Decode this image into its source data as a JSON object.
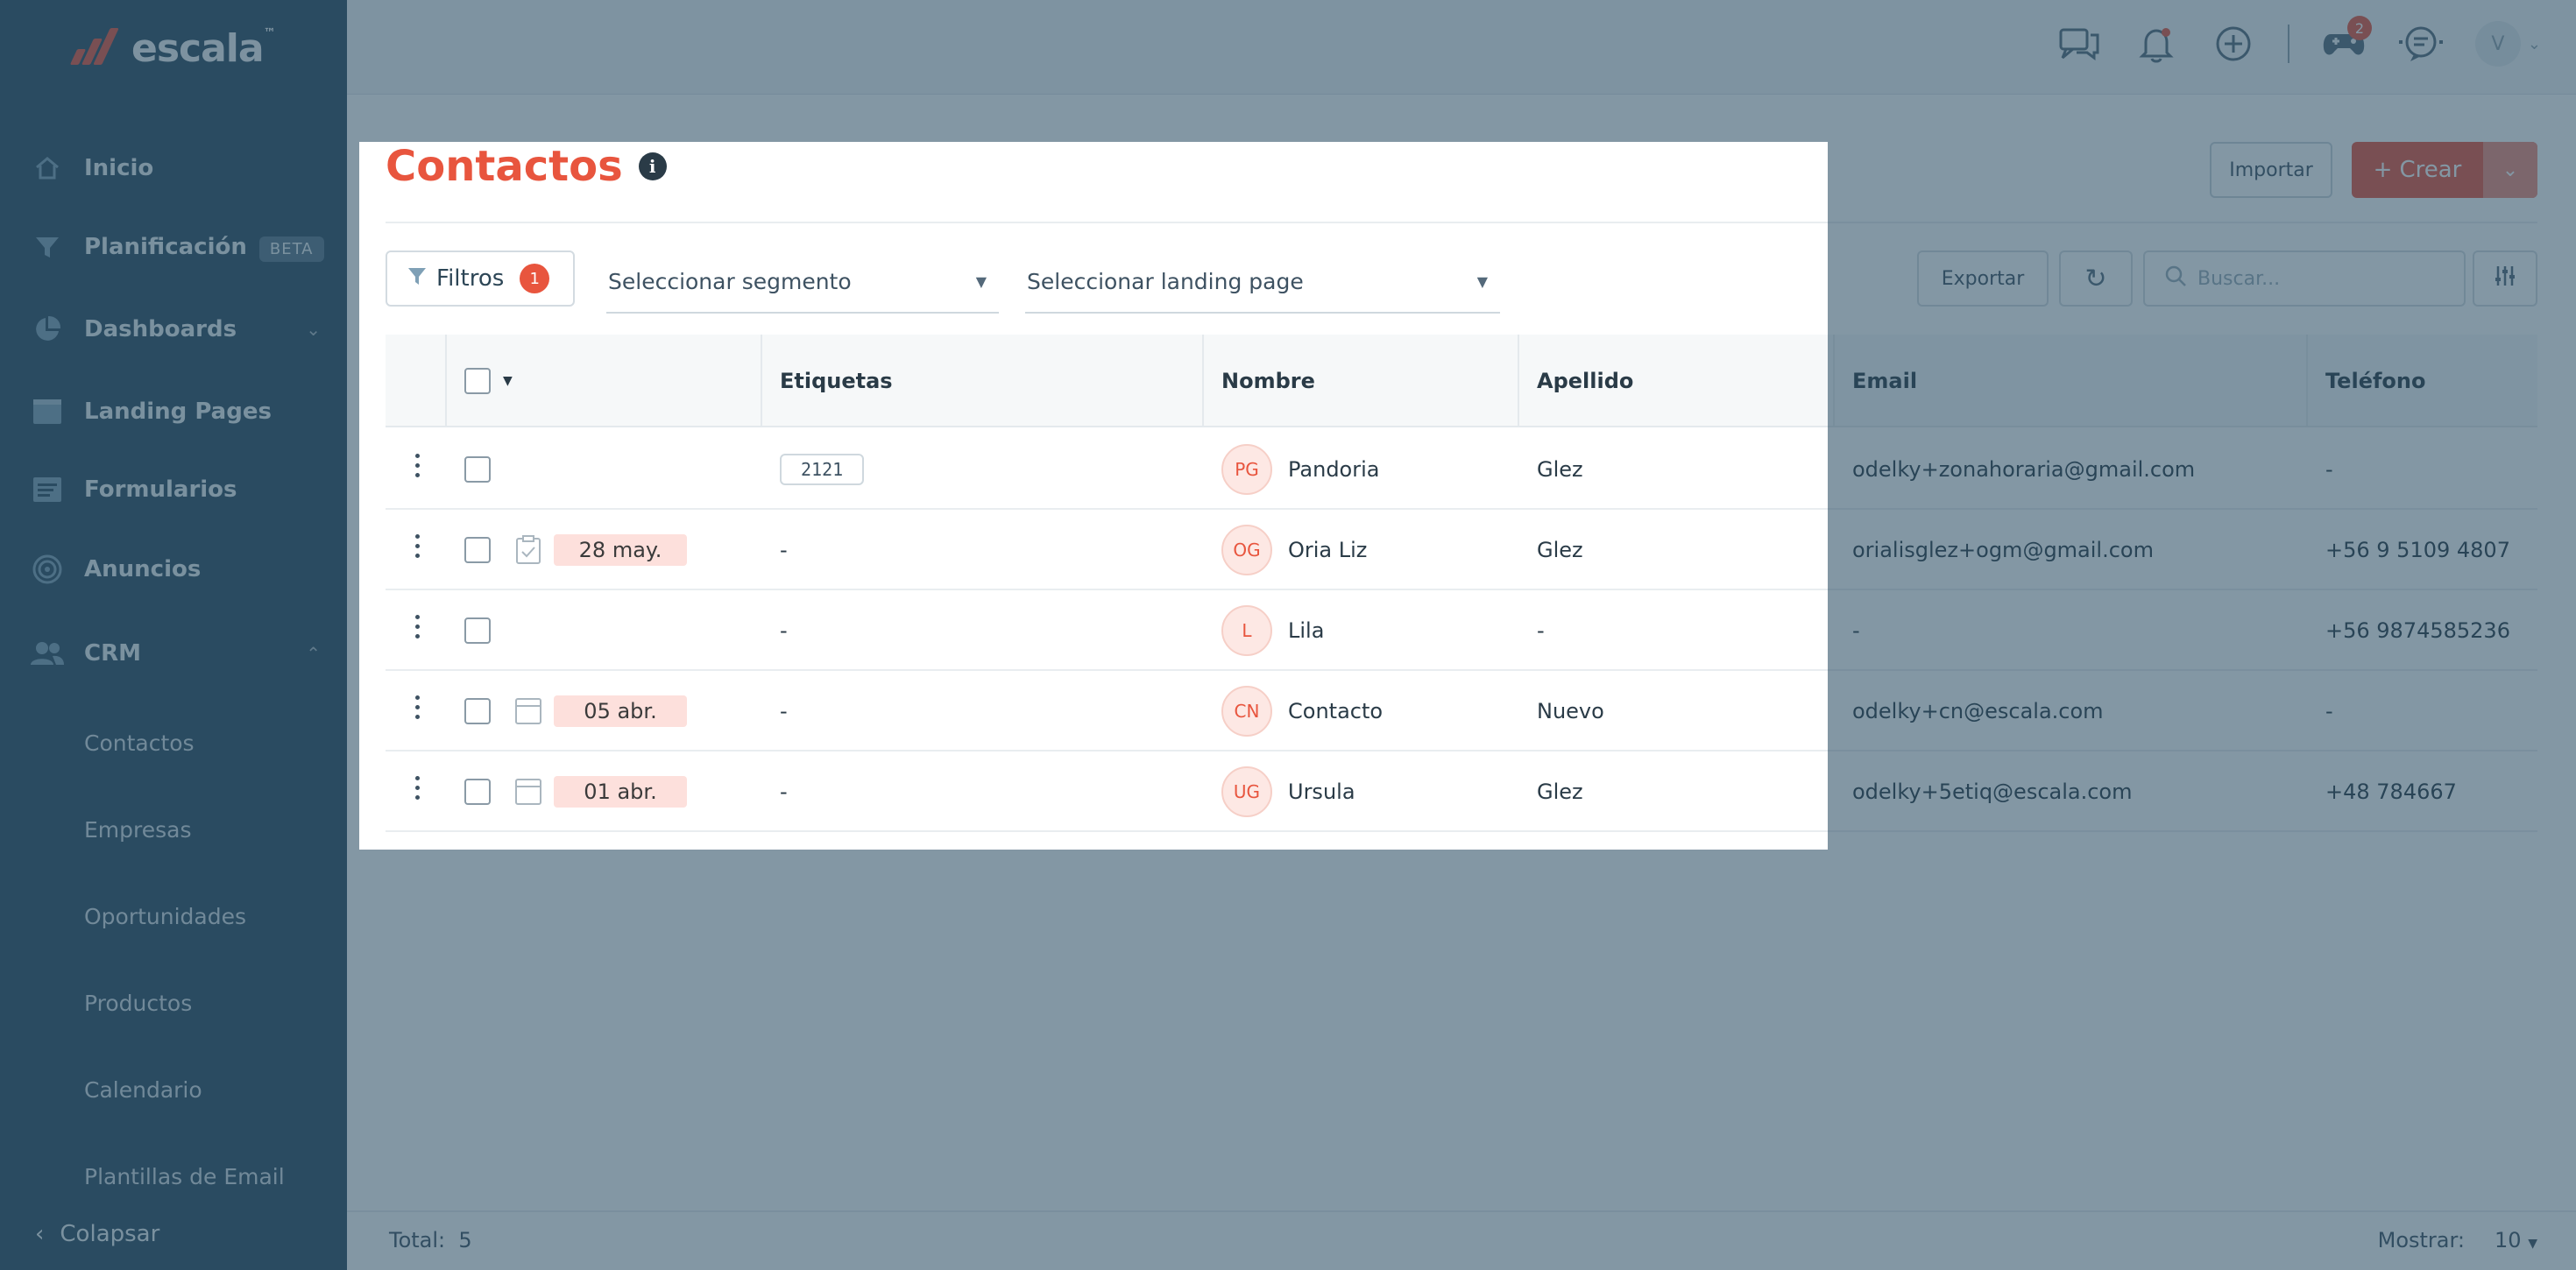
{
  "app": {
    "logo_text": "escala",
    "logo_tm": "™"
  },
  "sidebar": {
    "items": [
      {
        "label": "Inicio",
        "icon": "home-icon"
      },
      {
        "label": "Planificación",
        "badge": "BETA",
        "icon": "funnel-icon"
      },
      {
        "label": "Dashboards",
        "icon": "pie-chart-icon"
      },
      {
        "label": "Landing Pages",
        "icon": "window-icon"
      },
      {
        "label": "Formularios",
        "icon": "form-icon"
      },
      {
        "label": "Anuncios",
        "icon": "target-icon"
      },
      {
        "label": "CRM",
        "icon": "users-icon"
      }
    ],
    "crm_sub": [
      "Contactos",
      "Empresas",
      "Oportunidades",
      "Productos",
      "Calendario",
      "Plantillas de Email"
    ],
    "collapse_label": "Colapsar"
  },
  "topbar": {
    "notif_count": "2",
    "avatar_initial": "V"
  },
  "page": {
    "title": "Contactos",
    "import_label": "Importar",
    "create_label": "Crear",
    "filters_label": "Filtros",
    "filters_count": "1",
    "segment_placeholder": "Seleccionar segmento",
    "landing_placeholder": "Seleccionar landing page",
    "export_label": "Exportar",
    "search_placeholder": "Buscar..."
  },
  "table": {
    "headers": [
      "Etiquetas",
      "Nombre",
      "Apellido",
      "Email",
      "Teléfono"
    ],
    "rows": [
      {
        "date": "",
        "icon": "",
        "tag": "2121",
        "initials": "PG",
        "nombre": "Pandoria",
        "apellido": "Glez",
        "email": "odelky+zonahoraria@gmail.com",
        "telefono": "-"
      },
      {
        "date": "28 may.",
        "icon": "clipboard-check-icon",
        "tag": "-",
        "initials": "OG",
        "nombre": "Oria Liz",
        "apellido": "Glez",
        "email": "orialisglez+ogm@gmail.com",
        "telefono": "+56 9 5109 4807"
      },
      {
        "date": "",
        "icon": "",
        "tag": "-",
        "initials": "L",
        "nombre": "Lila",
        "apellido": "-",
        "email": "-",
        "telefono": "+56 9874585236"
      },
      {
        "date": "05 abr.",
        "icon": "calendar-icon",
        "tag": "-",
        "initials": "CN",
        "nombre": "Contacto",
        "apellido": "Nuevo",
        "email": "odelky+cn@escala.com",
        "telefono": "-"
      },
      {
        "date": "01 abr.",
        "icon": "calendar-icon",
        "tag": "-",
        "initials": "UG",
        "nombre": "Ursula",
        "apellido": "Glez",
        "email": "odelky+5etiq@escala.com",
        "telefono": "+48 784667"
      }
    ]
  },
  "footer": {
    "total_label": "Total:",
    "total_value": "5",
    "show_label": "Mostrar:",
    "show_value": "10"
  }
}
